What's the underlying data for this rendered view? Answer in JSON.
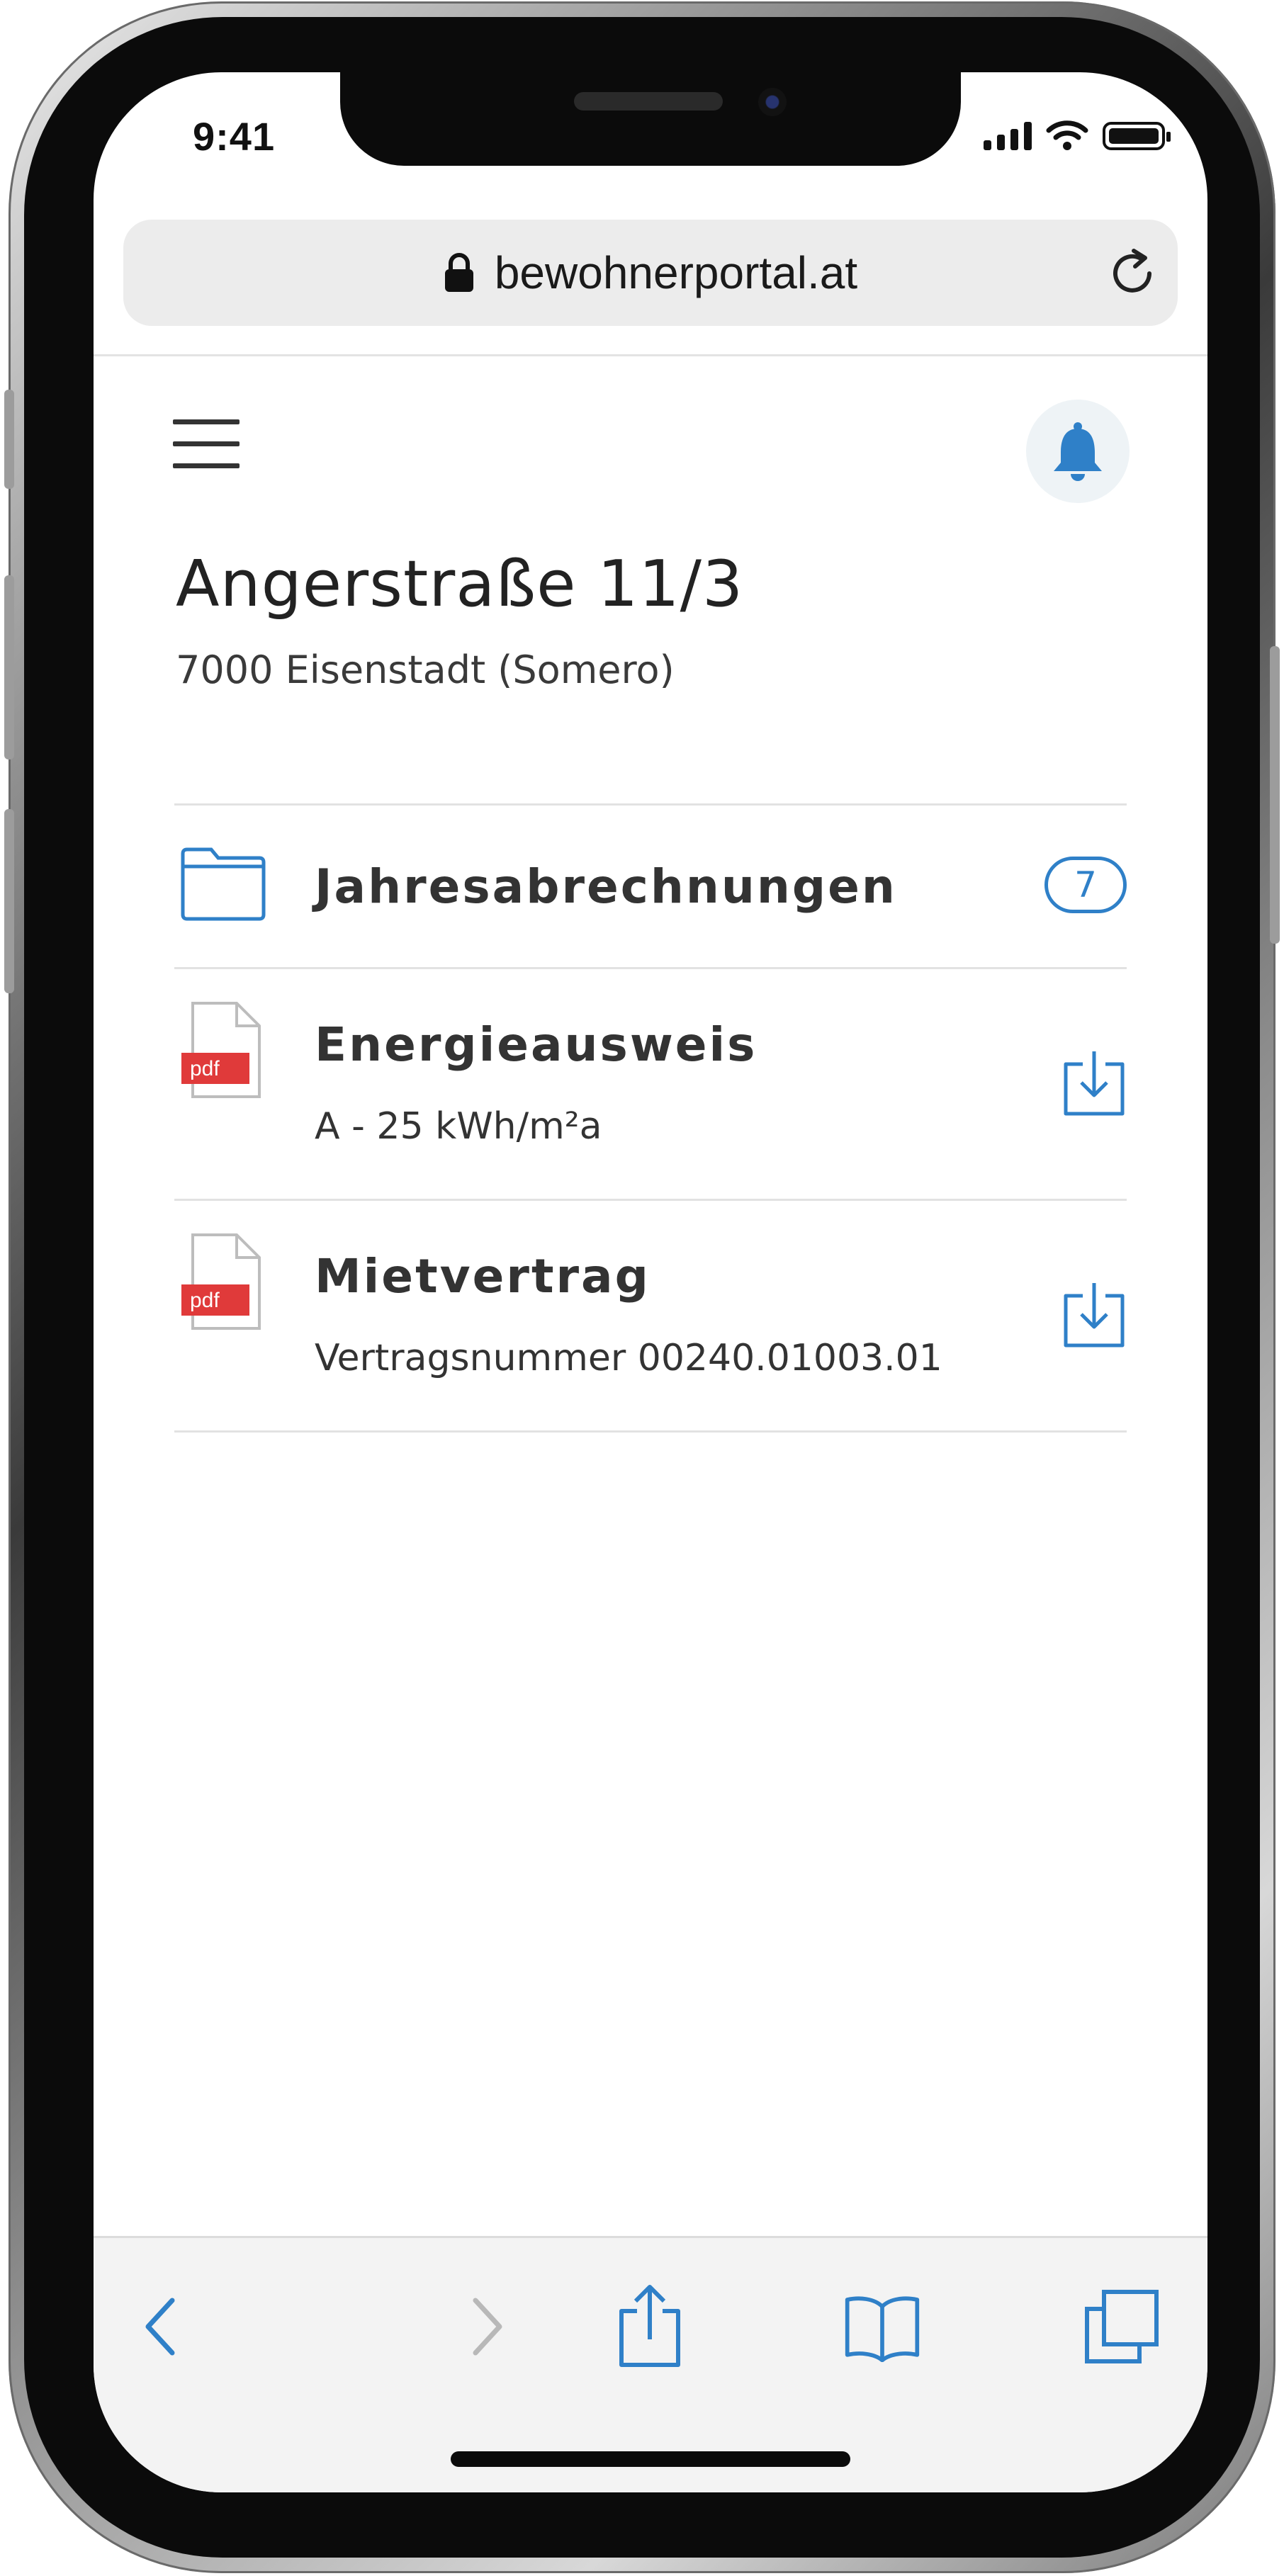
{
  "status_bar": {
    "time": "9:41"
  },
  "browser": {
    "url": "bewohnerportal.at"
  },
  "header": {
    "title": "Angerstraße 11/3",
    "subtitle": "7000 Eisenstadt (Somero)"
  },
  "items": [
    {
      "title": "Jahresabrechnungen",
      "count": "7",
      "icon": "folder-icon"
    },
    {
      "title": "Energieausweis",
      "subtitle": "A - 25 kWh/m²a",
      "file_badge": "pdf",
      "icon": "pdf-file-icon",
      "action": "download-icon"
    },
    {
      "title": "Mietvertrag",
      "subtitle": "Vertragsnummer 00240.01003.01",
      "file_badge": "pdf",
      "icon": "pdf-file-icon",
      "action": "download-icon"
    }
  ],
  "toolbar": {
    "icons": [
      "back-icon",
      "forward-icon",
      "share-icon",
      "bookmarks-icon",
      "tabs-icon"
    ]
  },
  "colors": {
    "accent": "#2f80c8",
    "pdf_red": "#e03a3a",
    "text": "#333333"
  }
}
